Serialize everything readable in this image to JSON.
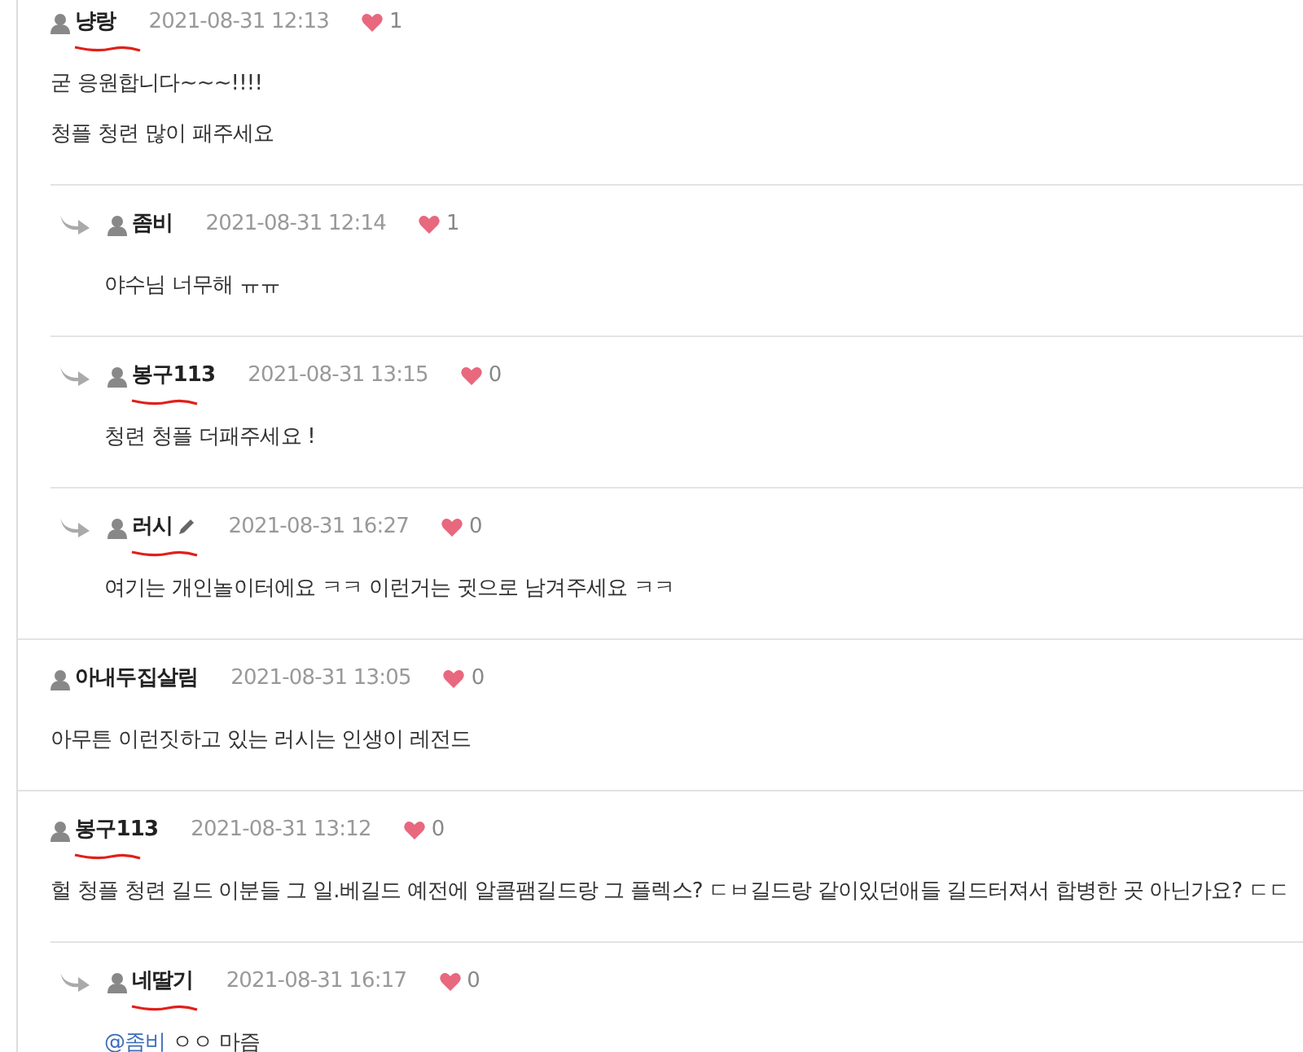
{
  "comments": [
    {
      "author": "냥랑",
      "underlined": true,
      "edited": false,
      "date": "2021-08-31 12:13",
      "likes": "1",
      "lines": [
        "굳 응원합니다~~~!!!!",
        "청플 청련 많이 패주세요"
      ],
      "replies": [
        {
          "author": "좀비",
          "underlined": false,
          "edited": false,
          "date": "2021-08-31 12:14",
          "likes": "1",
          "lines": [
            "야수님 너무해 ㅠㅠ"
          ]
        },
        {
          "author": "봉구113",
          "underlined": true,
          "edited": false,
          "date": "2021-08-31 13:15",
          "likes": "0",
          "lines": [
            "청련 청플 더패주세요 !"
          ]
        },
        {
          "author": "러시",
          "underlined": true,
          "edited": true,
          "date": "2021-08-31 16:27",
          "likes": "0",
          "lines": [
            "여기는 개인놀이터에요 ㅋㅋ 이런거는 귓으로 남겨주세요 ㅋㅋ"
          ]
        }
      ]
    },
    {
      "author": "아내두집살림",
      "underlined": false,
      "edited": false,
      "date": "2021-08-31 13:05",
      "likes": "0",
      "lines": [
        "아무튼 이런짓하고 있는 러시는 인생이 레전드"
      ]
    },
    {
      "author": "봉구113",
      "underlined": true,
      "edited": false,
      "date": "2021-08-31 13:12",
      "likes": "0",
      "lines": [
        "헐 청플 청련 길드 이분들 그 일.베길드 예전에 알콜팸길드랑 그 플렉스? ㄷㅂ길드랑 같이있던애들 길드터져서 합병한 곳 아닌가요? ㄷㄷ"
      ],
      "replies": [
        {
          "author": "네딸기",
          "underlined": true,
          "edited": false,
          "date": "2021-08-31 16:17",
          "likes": "0",
          "mention": "@좀비",
          "lines": [
            "ㅇㅇ 마즘"
          ]
        }
      ]
    }
  ]
}
